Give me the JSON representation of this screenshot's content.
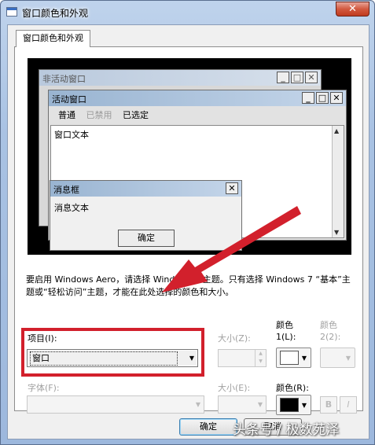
{
  "window": {
    "title": "窗口颜色和外观",
    "close_label": "✕"
  },
  "tab": {
    "label": "窗口颜色和外观"
  },
  "preview": {
    "inactive_title": "非活动窗口",
    "active_title": "活动窗口",
    "menu": [
      "普通",
      "已禁用",
      "已选定"
    ],
    "window_text": "窗口文本",
    "message_title": "消息框",
    "message_text": "消息文本",
    "ok_label": "确定",
    "min_glyph": "_",
    "max_glyph": "□",
    "close_glyph": "✕"
  },
  "description": "要启用 Windows Aero，请选择 Windows 7 主题。只有选择 Windows 7 “基本”主题或“轻松访问”主题，才能在此处选择的颜色和大小。",
  "form": {
    "item_label": "项目(I):",
    "item_value": "窗口",
    "item_size_label": "大小(Z):",
    "color1_label_a": "颜色",
    "color1_label_b": "1(L):",
    "color2_label_a": "颜色",
    "color2_label_b": "2(2):",
    "font_label": "字体(F):",
    "font_size_label": "大小(E):",
    "font_color_label": "颜色(R):",
    "bold_label": "B",
    "italic_label": "I",
    "color1_value": "#ffffff",
    "font_color_value": "#000000"
  },
  "buttons": {
    "ok": "确定",
    "cancel": "取消"
  },
  "watermark": "头条号 / 极数苑泽",
  "colors": {
    "highlight_border": "#d2202c",
    "arrow": "#d2202c"
  }
}
